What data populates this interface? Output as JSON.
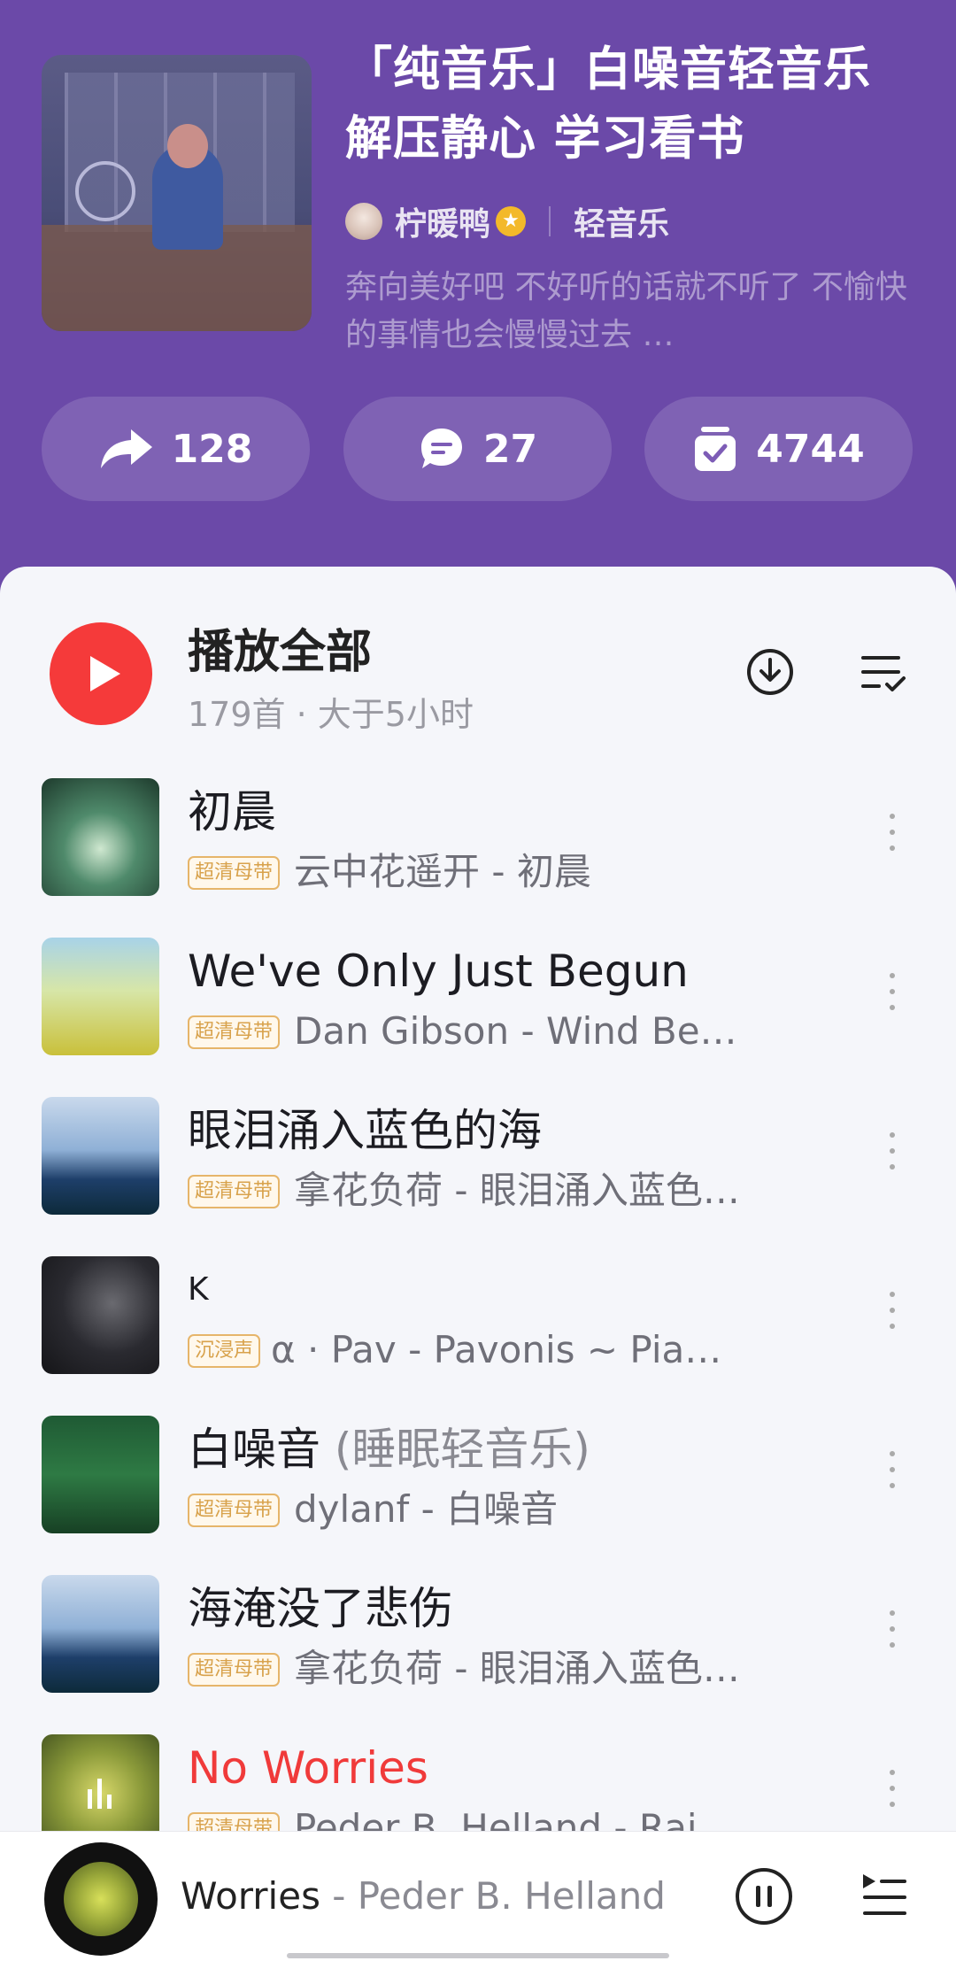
{
  "playlist": {
    "title": "「纯音乐」白噪音轻音乐 解压静心 学习看书",
    "author": "柠暖鸭",
    "tag": "轻音乐",
    "description": "奔向美好吧 不好听的话就不听了 不愉快的事情也会慢慢过去 …"
  },
  "stats": {
    "share_count": "128",
    "comment_count": "27",
    "collect_count": "4744"
  },
  "play_all": {
    "label": "播放全部",
    "meta": "179首 · 大于5小时"
  },
  "songs": [
    {
      "title": "初晨",
      "title_sub": "",
      "badge": "超清母带",
      "artist_album": "云中花遥开 - 初晨"
    },
    {
      "title": "We've Only Just Begun",
      "title_sub": "",
      "badge": "超清母带",
      "artist_album": "Dan Gibson - Wind Be…"
    },
    {
      "title": "眼泪涌入蓝色的海",
      "title_sub": "",
      "badge": "超清母带",
      "artist_album": "拿花负荷 - 眼泪涌入蓝色…"
    },
    {
      "title": "K",
      "title_sub": "",
      "badge": "沉浸声",
      "artist_album": "α · Pav - Pavonis ~ Pia…"
    },
    {
      "title": "白噪音",
      "title_sub": " (睡眠轻音乐)",
      "badge": "超清母带",
      "artist_album": "dylanf - 白噪音"
    },
    {
      "title": "海淹没了悲伤",
      "title_sub": "",
      "badge": "超清母带",
      "artist_album": "拿花负荷 - 眼泪涌入蓝色…"
    },
    {
      "title": "No Worries",
      "title_sub": "",
      "badge": "超清母带",
      "artist_album": "Peder B. Helland - Rai…"
    }
  ],
  "now_playing": {
    "title": "Worries",
    "artist": " - Peder B. Helland"
  },
  "colors": {
    "header_bg": "#6b49a8",
    "accent_red": "#f53a3a",
    "playing_title": "#f03a3a",
    "badge_gold": "#d8a24c"
  }
}
